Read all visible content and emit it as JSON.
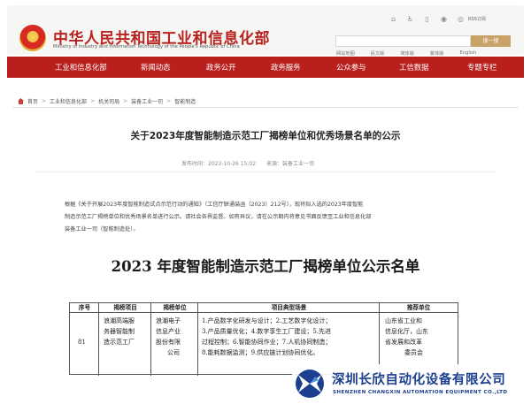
{
  "header": {
    "site_title": "中华人民共和国工业和信息化部",
    "site_subtitle": "Ministry of Industry and Information Technology of the People's Republic of China",
    "rss_label": "RSS订阅",
    "search": {
      "placeholder": "",
      "button_label": "搜一搜"
    },
    "quick_links": [
      "网站地图",
      "民文版",
      "简体版",
      "繁体版",
      "English"
    ]
  },
  "nav": {
    "items": [
      "工业和信息化部",
      "新闻动态",
      "政务公开",
      "政务服务",
      "公众参与",
      "工信数据",
      "专题专栏"
    ]
  },
  "breadcrumb": [
    "首页",
    "工业和信息化部",
    "机关司局",
    "装备工业一司",
    "智能制造"
  ],
  "article": {
    "title": "关于2023年度智能制造示范工厂揭榜单位和优秀场景名单的公示",
    "meta_date": "发布时间：2023-10-26 15:02",
    "meta_source": "来源：装备工业一司",
    "paragraph_lines": [
      "根据《关于开展2023年度智能制造试点示范行动的通知》（工信厅联通装函〔2023〕212号），现将拟入选的2023年度智能",
      "制造示范工厂揭榜单位和优秀场景名单进行公示。请社会各界监督。如有异议，请在公示期内将意见书面反馈至工业和信息化部",
      "装备工业一司（智能制造处）。"
    ],
    "list_heading": "2023 年度智能制造示范工厂揭榜单位公示名单"
  },
  "table": {
    "headers": [
      "序号",
      "揭榜项目",
      "揭榜单位",
      "项目典型场景",
      "推荐单位"
    ],
    "row": {
      "index": "81",
      "project": [
        "浪潮高端服",
        "务器智能制",
        "造示范工厂"
      ],
      "unit": [
        "浪潮电子",
        "信息产业",
        "股份有限",
        "公司"
      ],
      "scenes": [
        "1.产品数字化研发与设计；2.工艺数字化设计；",
        "3.产品质量优化；4.数字孪生工厂建设；5.先进",
        "过程控制；6.智能协同作业；7.人机协同制造；",
        "8.能耗数据监测；9.供应链计划协同优化。"
      ],
      "recommender": [
        "山东省工业和",
        "信息化厅，山东",
        "省发展和改革",
        "委员会"
      ]
    }
  },
  "watermark": {
    "company_cn": "深圳长欣自动化设备有限公司",
    "company_en": "SHENZHEN CHANGXIN AUTOMATION EQUIPMENT CO.,LTD"
  },
  "colors": {
    "brand_red": "#b91f1d",
    "title_red": "#b9221e",
    "search_gold": "#c8a267",
    "watermark_blue": "#1c3f8f"
  },
  "icons": [
    "home-icon",
    "accessibility-icon",
    "mobile-icon",
    "wechat-icon",
    "weibo-icon",
    "emblem-icon"
  ]
}
